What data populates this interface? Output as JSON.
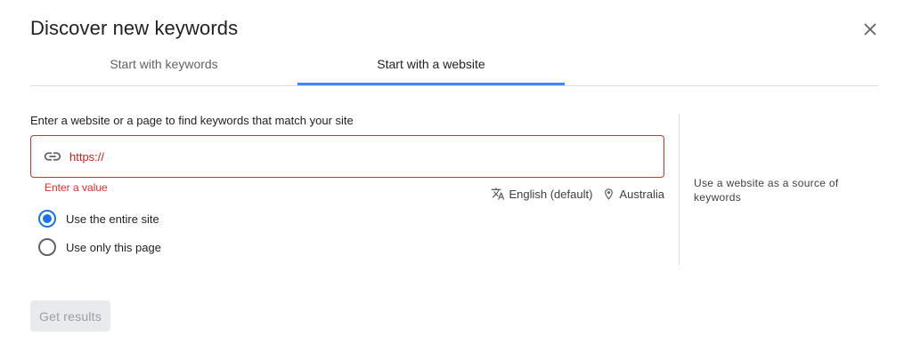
{
  "dialog": {
    "title": "Discover new keywords",
    "close_icon": "close-icon"
  },
  "tabs": [
    {
      "label": "Start with keywords",
      "active": false
    },
    {
      "label": "Start with a website",
      "active": true
    }
  ],
  "website_form": {
    "prompt": "Enter a website or a page to find keywords that match your site",
    "url_value": "https://",
    "error": "Enter a value",
    "language": "English (default)",
    "location": "Australia",
    "scope_options": [
      {
        "label": "Use the entire site",
        "selected": true
      },
      {
        "label": "Use only this page",
        "selected": false
      }
    ]
  },
  "side_note": "Use a website as a source of keywords",
  "footer": {
    "submit_label": "Get results",
    "submit_enabled": false
  },
  "colors": {
    "accent": "#1a73e8",
    "tab_indicator": "#4285f4",
    "error": "#d93025"
  }
}
